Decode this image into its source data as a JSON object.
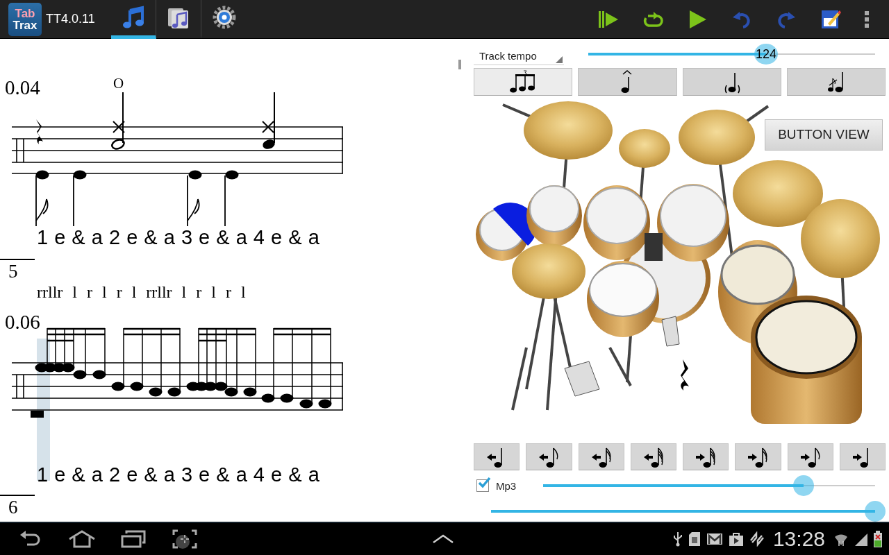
{
  "app_bar": {
    "logo": {
      "line_1": "Tab",
      "line_2": "Trax"
    },
    "title": "TT4.0.11",
    "tabs": [
      {
        "kind": "notes",
        "selected": true
      },
      {
        "kind": "library",
        "selected": false
      },
      {
        "kind": "settings",
        "selected": false
      }
    ]
  },
  "score": {
    "systems": [
      {
        "kind": "groove",
        "time": "0.04",
        "open_mark": "O",
        "counting": "1 e & a 2 e & a 3 e & a 4 e & a"
      },
      {
        "kind": "sticking",
        "number": "5",
        "sticking": "rrllr  l  r  l  r  l  rrllr  l  r  l  r  l",
        "time": "0.06",
        "counting": "1 e & a 2 e & a 3 e & a 4 e & a",
        "playhead": true
      }
    ],
    "next_number": "6"
  },
  "tempo": {
    "label": "Track tempo",
    "value": "124",
    "level": 0.62
  },
  "note_buttons": [
    {
      "kind": "triplet",
      "selected": true
    },
    {
      "kind": "accent",
      "selected": false
    },
    {
      "kind": "ghost",
      "selected": false
    },
    {
      "kind": "flam",
      "selected": false
    }
  ],
  "button_view": "BUTTON VIEW",
  "nudge_buttons": [
    {
      "kind": "left_quarter"
    },
    {
      "kind": "left_eighth"
    },
    {
      "kind": "left_sixteenth"
    },
    {
      "kind": "left_thirty_second"
    },
    {
      "kind": "right_thirty_second"
    },
    {
      "kind": "right_sixteenth"
    },
    {
      "kind": "right_eighth"
    },
    {
      "kind": "right_quarter"
    }
  ],
  "mp3": {
    "label": "Mp3",
    "checked": true,
    "level": 0.785
  },
  "volume": {
    "level": 1
  },
  "status_bar": {
    "time": "13:28"
  }
}
